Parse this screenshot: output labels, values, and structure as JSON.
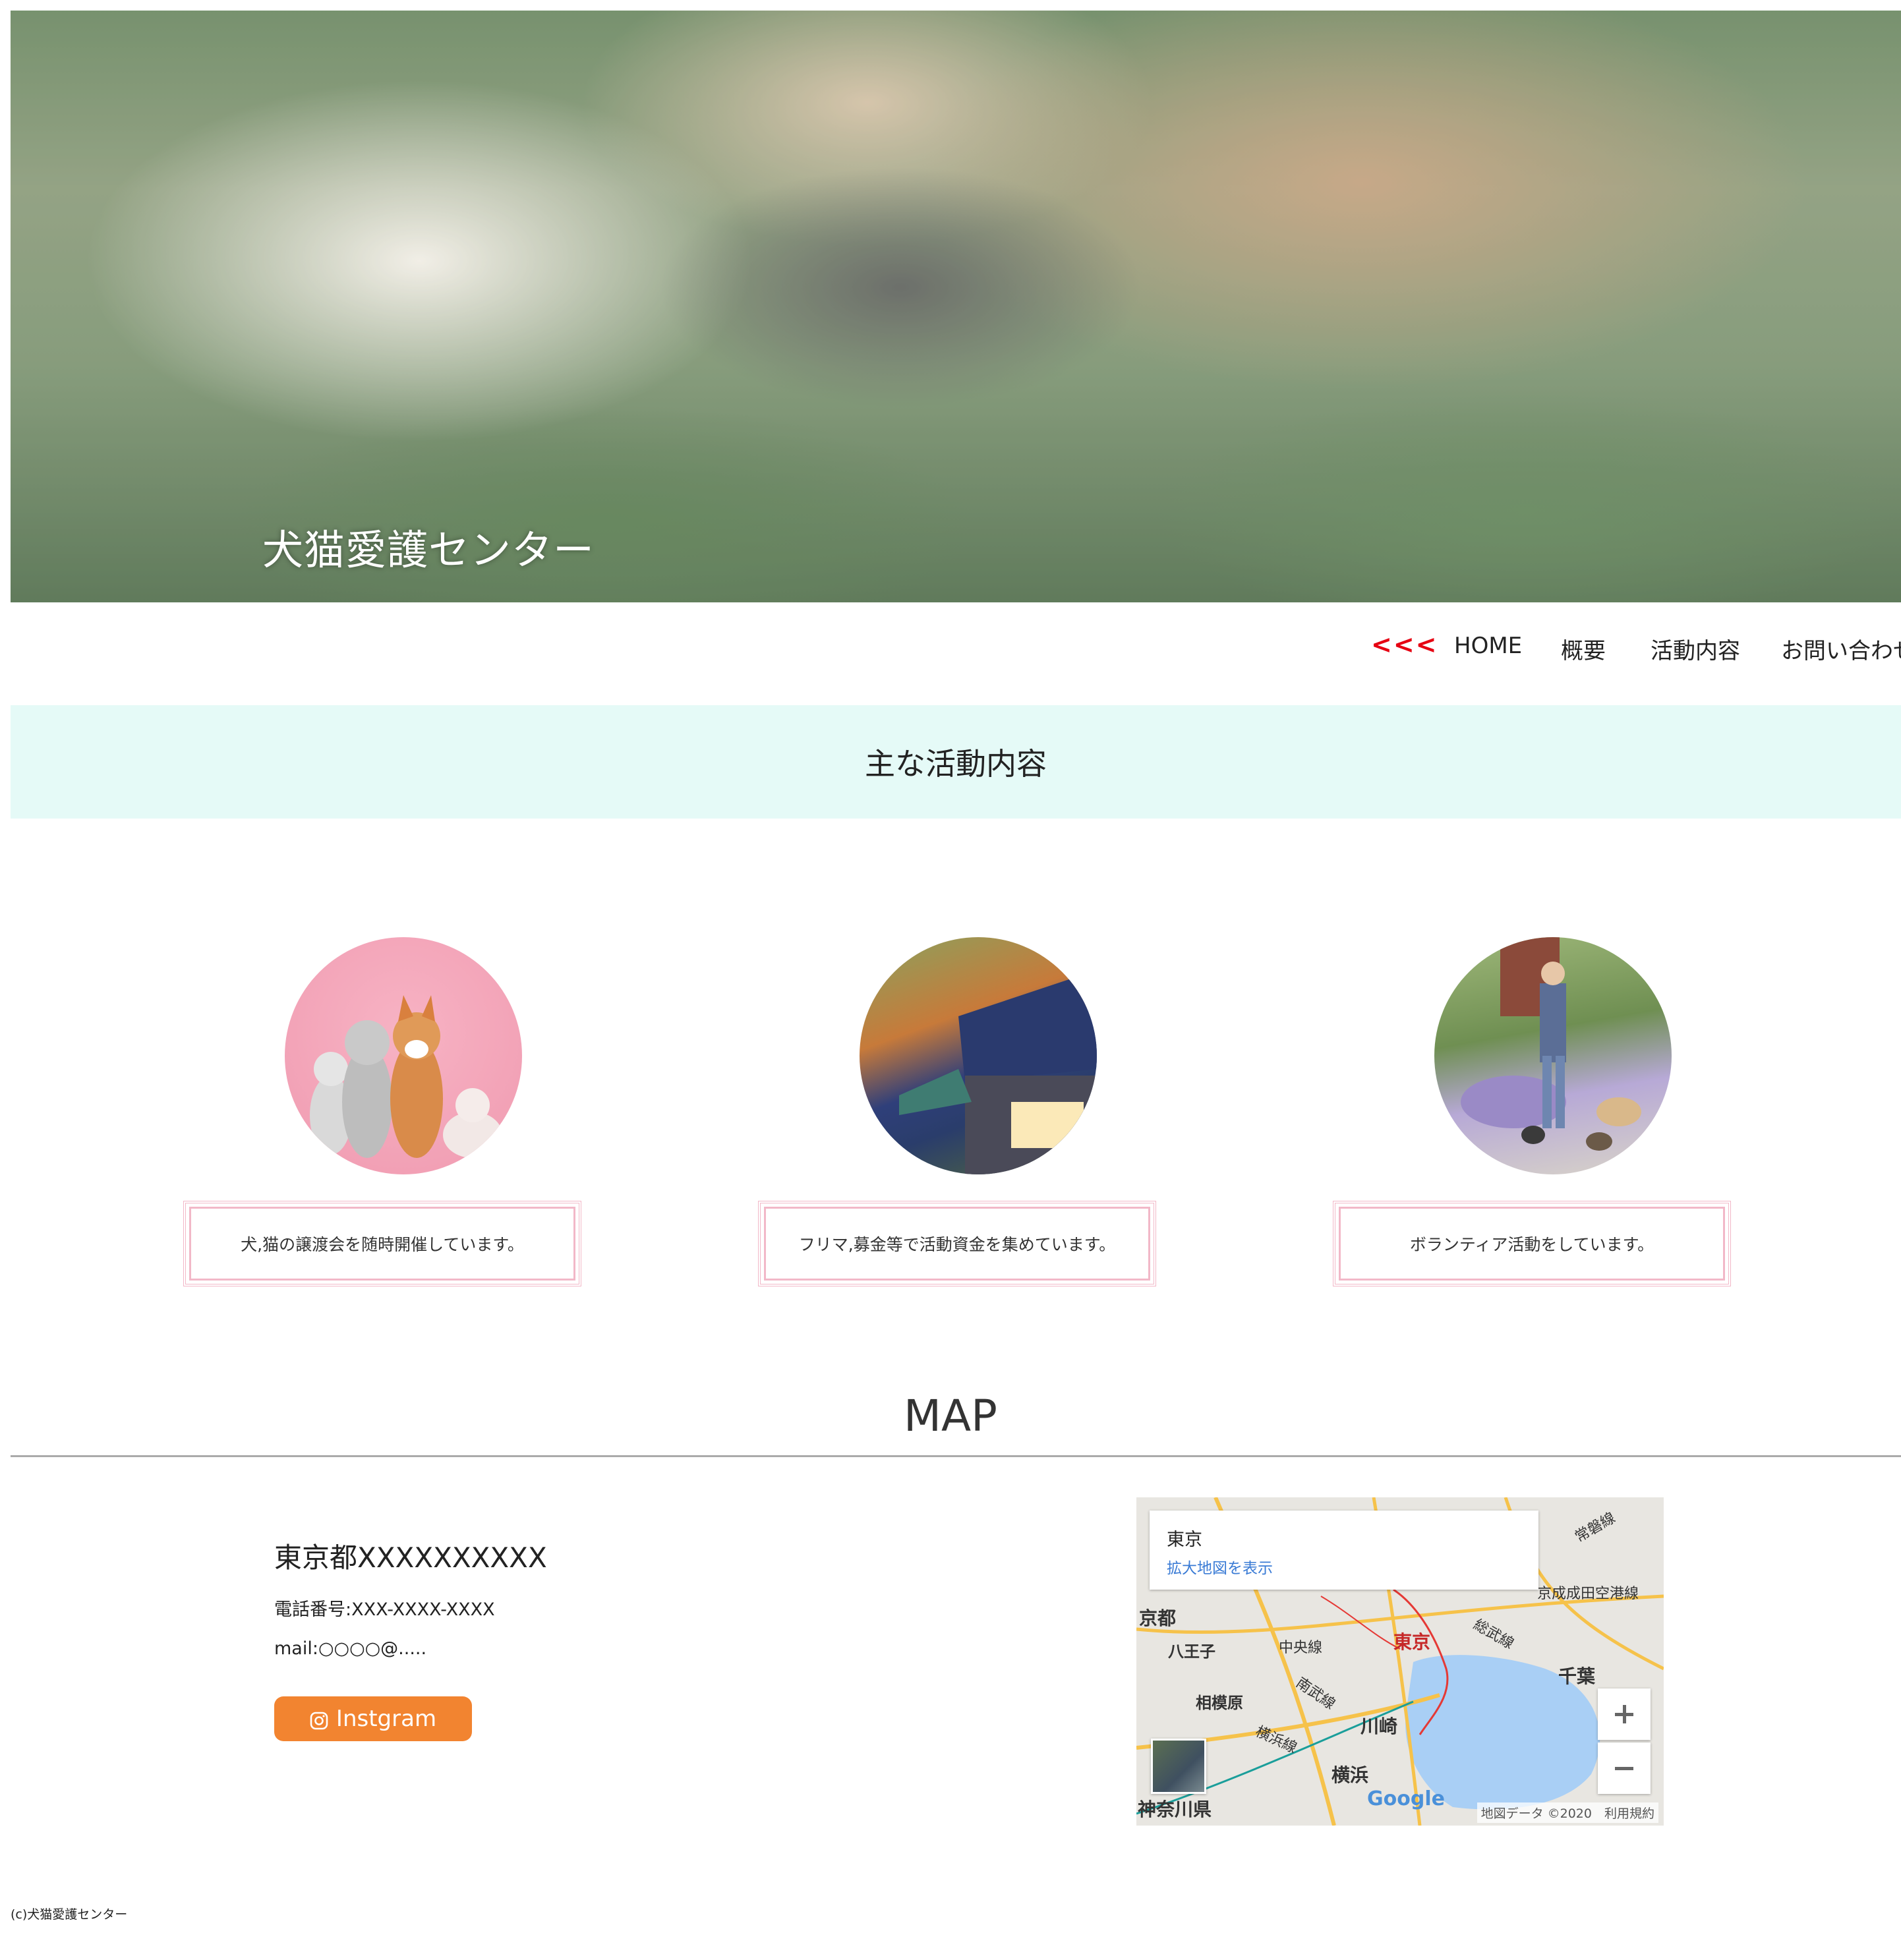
{
  "hero": {
    "title": "犬猫愛護センター",
    "image": "dog-and-cat-lying-in-grass"
  },
  "nav": {
    "arrow": "<<<",
    "items": [
      {
        "label": "HOME"
      },
      {
        "label": "概要"
      },
      {
        "label": "活動内容"
      },
      {
        "label": "お問い合わせ"
      }
    ]
  },
  "section": {
    "title": "主な活動内容"
  },
  "activities": [
    {
      "caption": "犬,猫の譲渡会を随時開催しています。",
      "image": "dogs-and-cat-on-pink-background"
    },
    {
      "caption": "フリマ,募金等で活動資金を集めています。",
      "image": "flea-market-tents"
    },
    {
      "caption": "ボランティア活動をしています。",
      "image": "woman-walking-dogs"
    }
  ],
  "map_section": {
    "heading": "MAP",
    "address": "東京都XXXXXXXXXX",
    "phone": "電話番号:XXX-XXXX-XXXX",
    "mail": "mail:○○○○@.....",
    "instagram_label": "Instgram",
    "instagram_icon": "instagram-icon"
  },
  "map_embed": {
    "place": "東京",
    "link": "拡大地図を表示",
    "labels": [
      "京都",
      "八王子",
      "中央線",
      "東京",
      "総武線",
      "千葉",
      "相模原",
      "南武線",
      "川崎",
      "横浜線",
      "横浜",
      "神奈川県",
      "京成成田空港線",
      "常磐線"
    ],
    "logo": "Google",
    "attribution": "地図データ ©2020　利用規約",
    "zoom_in": "+",
    "zoom_out": "−",
    "colors": {
      "water": "#a9cff5",
      "land": "#e8e6e1",
      "highway": "#f6c24a",
      "boundary": "#e53935"
    }
  },
  "footer": {
    "text": "(c)犬猫愛護センター"
  },
  "colors": {
    "accent_red": "#e60012",
    "band_bg": "#e5faf7",
    "card_border": "#f2b8c8",
    "button_orange": "#f28430"
  }
}
